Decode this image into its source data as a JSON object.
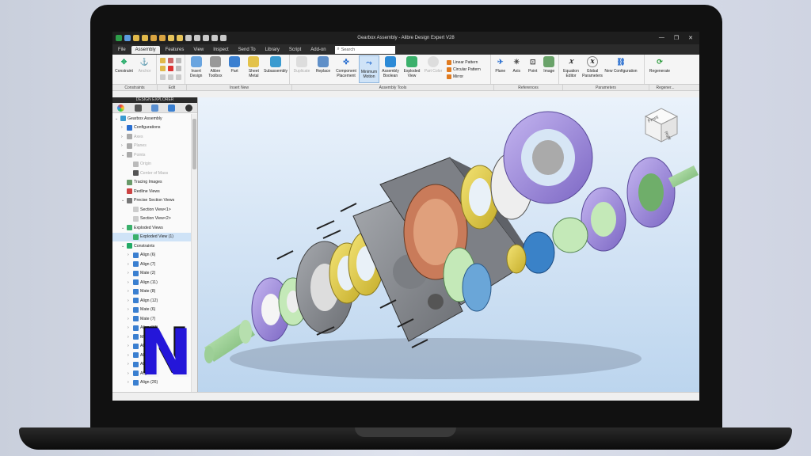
{
  "window": {
    "title": "Gearbox Assembly - Alibre Design Expert V28",
    "controls": [
      "—",
      "❐",
      "✕"
    ]
  },
  "menu": {
    "tabs": [
      "File",
      "Assembly",
      "Features",
      "View",
      "Inspect",
      "Send To",
      "Library",
      "Script",
      "Add-on"
    ],
    "active_tab": "Assembly",
    "search_placeholder": "Search"
  },
  "ribbon": {
    "constraints": [
      {
        "label": "Constraint",
        "icon": "constraint-icon",
        "dim": false
      },
      {
        "label": "Anchor",
        "icon": "anchor-icon",
        "dim": true
      }
    ],
    "insert": [
      {
        "label": "Insert Design",
        "icon": "insert-design-icon"
      },
      {
        "label": "Alibre Toolbox",
        "icon": "toolbox-icon"
      },
      {
        "label": "Part",
        "icon": "part-icon"
      },
      {
        "label": "Sheet Metal",
        "icon": "sheet-metal-icon"
      },
      {
        "label": "Subassembly",
        "icon": "subassembly-icon"
      }
    ],
    "tools": [
      {
        "label": "Duplicate",
        "icon": "duplicate-icon",
        "dim": true
      },
      {
        "label": "Replace",
        "icon": "replace-icon",
        "dim": false
      },
      {
        "label": "Component Placement",
        "icon": "placement-icon",
        "dim": false
      },
      {
        "label": "Minimum Motion",
        "icon": "motion-icon",
        "dim": false,
        "selected": true
      },
      {
        "label": "Assembly Boolean",
        "icon": "boolean-icon",
        "dim": false
      },
      {
        "label": "Exploded View",
        "icon": "exploded-icon",
        "dim": false
      },
      {
        "label": "Part Color",
        "icon": "color-icon",
        "dim": true
      }
    ],
    "patterns": [
      "Linear Pattern",
      "Circular Pattern",
      "Mirror"
    ],
    "references": [
      {
        "label": "Plane",
        "icon": "plane-icon"
      },
      {
        "label": "Axis",
        "icon": "axis-icon"
      },
      {
        "label": "Point",
        "icon": "point-icon"
      },
      {
        "label": "Image",
        "icon": "image-icon"
      }
    ],
    "parameters": [
      {
        "label": "Equation Editor",
        "icon": "equation-icon"
      },
      {
        "label": "Global Parameters",
        "icon": "global-params-icon"
      },
      {
        "label": "New Configuration",
        "icon": "configuration-icon"
      }
    ],
    "regenerate": [
      {
        "label": "Regenerate",
        "icon": "regenerate-icon"
      }
    ],
    "group_labels": [
      "Constraints",
      "Edit",
      "Insert New",
      "Assembly Tools",
      "References",
      "Parameters",
      "Regener..."
    ]
  },
  "explorer": {
    "header": "DESIGN EXPLORER",
    "tree": [
      {
        "label": "Gearbox Assembly",
        "indent": 0,
        "tw": "⌄",
        "icon": "assembly-icon",
        "dim": false
      },
      {
        "label": "Configurations",
        "indent": 1,
        "tw": "›",
        "icon": "configurations-icon",
        "dim": false
      },
      {
        "label": "Axes",
        "indent": 1,
        "tw": "›",
        "icon": "axes-icon",
        "dim": true
      },
      {
        "label": "Planes",
        "indent": 1,
        "tw": "›",
        "icon": "planes-icon",
        "dim": true
      },
      {
        "label": "Points",
        "indent": 1,
        "tw": "⌄",
        "icon": "points-icon",
        "dim": true
      },
      {
        "label": "Origin",
        "indent": 2,
        "tw": "",
        "icon": "origin-icon",
        "dim": true
      },
      {
        "label": "Center of Mass",
        "indent": 2,
        "tw": "",
        "icon": "center-mass-icon",
        "dim": true
      },
      {
        "label": "Tracing Images",
        "indent": 1,
        "tw": "",
        "icon": "tracing-icon",
        "dim": false
      },
      {
        "label": "Redline Views",
        "indent": 1,
        "tw": "",
        "icon": "redline-icon",
        "dim": false
      },
      {
        "label": "Precise Section Views",
        "indent": 1,
        "tw": "⌄",
        "icon": "section-icon",
        "dim": false
      },
      {
        "label": "Section View<1>",
        "indent": 2,
        "tw": "",
        "icon": "section-view-icon",
        "dim": false
      },
      {
        "label": "Section View<2>",
        "indent": 2,
        "tw": "",
        "icon": "section-view-icon",
        "dim": false
      },
      {
        "label": "Exploded Views",
        "indent": 1,
        "tw": "⌄",
        "icon": "exploded-views-icon",
        "dim": false
      },
      {
        "label": "Exploded View (1)",
        "indent": 2,
        "tw": "",
        "icon": "exploded-view-icon",
        "dim": false,
        "hl": true
      },
      {
        "label": "Constraints",
        "indent": 1,
        "tw": "⌄",
        "icon": "constraints-icon",
        "dim": false
      },
      {
        "label": "Align (6)",
        "indent": 2,
        "tw": "›",
        "icon": "align-icon",
        "dim": false
      },
      {
        "label": "Align (7)",
        "indent": 2,
        "tw": "›",
        "icon": "align-icon",
        "dim": false
      },
      {
        "label": "Mate (2)",
        "indent": 2,
        "tw": "›",
        "icon": "mate-icon",
        "dim": false
      },
      {
        "label": "Align (11)",
        "indent": 2,
        "tw": "›",
        "icon": "align-icon",
        "dim": false
      },
      {
        "label": "Mate (8)",
        "indent": 2,
        "tw": "›",
        "icon": "mate-icon",
        "dim": false
      },
      {
        "label": "Align (12)",
        "indent": 2,
        "tw": "›",
        "icon": "align-icon",
        "dim": false
      },
      {
        "label": "Mate (6)",
        "indent": 2,
        "tw": "›",
        "icon": "mate-icon",
        "dim": false
      },
      {
        "label": "Mate (7)",
        "indent": 2,
        "tw": "›",
        "icon": "mate-icon",
        "dim": false
      },
      {
        "label": "Align (13)",
        "indent": 2,
        "tw": "›",
        "icon": "align-icon",
        "dim": false
      },
      {
        "label": "Mate",
        "indent": 2,
        "tw": "›",
        "icon": "mate-icon",
        "dim": false
      },
      {
        "label": "Align",
        "indent": 2,
        "tw": "›",
        "icon": "align-icon",
        "dim": false
      },
      {
        "label": "Align",
        "indent": 2,
        "tw": "›",
        "icon": "align-icon",
        "dim": false
      },
      {
        "label": "Align",
        "indent": 2,
        "tw": "›",
        "icon": "align-icon",
        "dim": false
      },
      {
        "label": "Align",
        "indent": 2,
        "tw": "›",
        "icon": "align-icon",
        "dim": false
      },
      {
        "label": "Align (26)",
        "indent": 2,
        "tw": "›",
        "icon": "align-icon",
        "dim": false
      }
    ]
  },
  "viewcube": {
    "front": "Front",
    "right": "Right"
  },
  "logo": {
    "letter": "N"
  },
  "colors": {
    "accent": "#2416d9",
    "viewport_top": "#eaf2fb",
    "viewport_bottom": "#bcd5ee",
    "housing": "#8a8d92",
    "purple": "#a18be0",
    "gold": "#e8d44a",
    "green": "#9ed59e",
    "copper": "#c97b5a"
  }
}
